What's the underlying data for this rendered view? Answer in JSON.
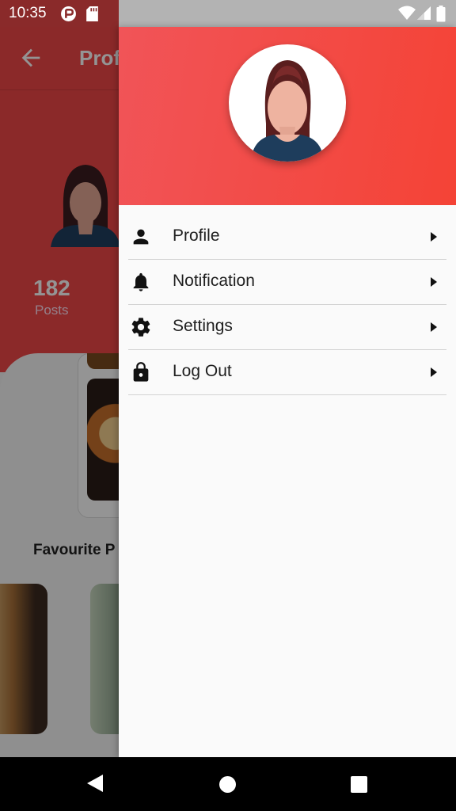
{
  "status_bar": {
    "time": "10:35",
    "icons": [
      "vpn-key-icon",
      "sd-card-icon",
      "wifi-icon",
      "signal-icon",
      "battery-icon"
    ]
  },
  "background": {
    "title": "Prof",
    "back_icon": "arrow-left-icon",
    "stat_count": "182",
    "stat_label": "Posts",
    "section_title": "Favourite P"
  },
  "drawer": {
    "avatar_icon": "woman-avatar-icon",
    "header_color": "#f44336",
    "menu": [
      {
        "label": "Profile",
        "icon": "person-icon"
      },
      {
        "label": "Notification",
        "icon": "bell-icon"
      },
      {
        "label": "Settings",
        "icon": "gear-icon"
      },
      {
        "label": "Log Out",
        "icon": "lock-icon"
      }
    ]
  },
  "nav_bar": {
    "icons": [
      "back-triangle-icon",
      "home-circle-icon",
      "recents-square-icon"
    ]
  }
}
